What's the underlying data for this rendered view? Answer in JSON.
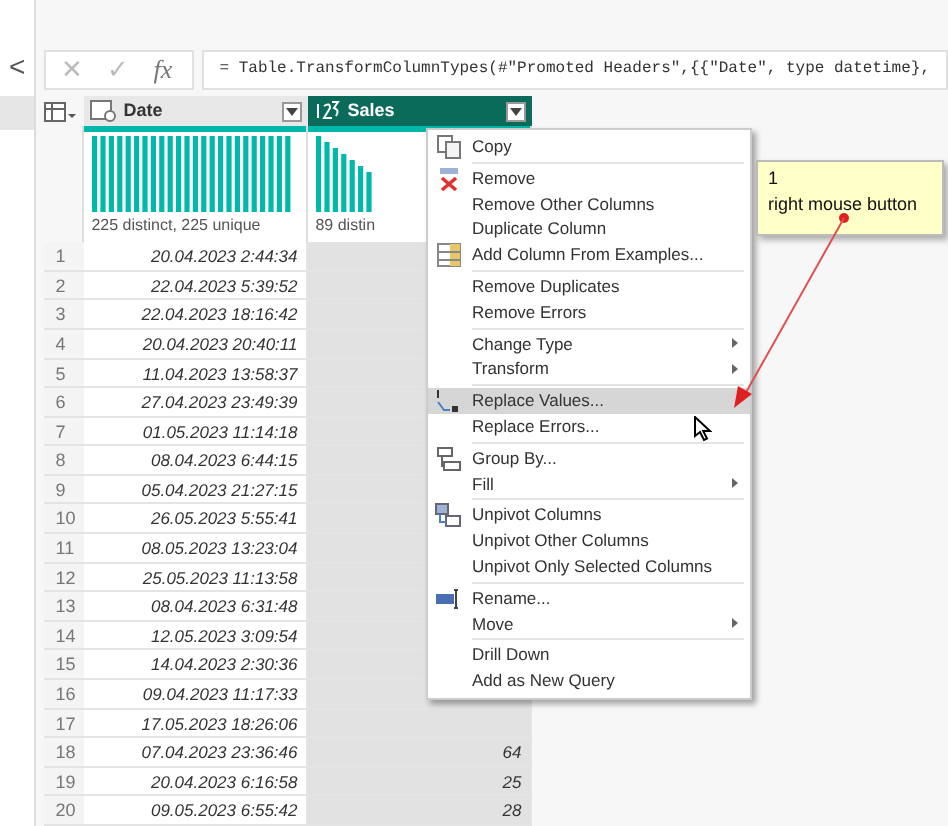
{
  "nav": {
    "collapse": "<"
  },
  "formula_bar": {
    "cancel": "✕",
    "commit": "✓",
    "fx": "fx",
    "formula": "= Table.TransformColumnTypes(#\"Promoted Headers\",{{\"Date\", type datetime},"
  },
  "table": {
    "columns": [
      {
        "name": "Date",
        "selected": false,
        "stats": "225 distinct, 225 unique"
      },
      {
        "name": "Sales",
        "selected": true,
        "stats": "89 distin"
      }
    ],
    "rows": [
      {
        "n": "1",
        "date": "20.04.2023 2:44:34"
      },
      {
        "n": "2",
        "date": "22.04.2023 5:39:52"
      },
      {
        "n": "3",
        "date": "22.04.2023 18:16:42"
      },
      {
        "n": "4",
        "date": "20.04.2023 20:40:11"
      },
      {
        "n": "5",
        "date": "11.04.2023 13:58:37"
      },
      {
        "n": "6",
        "date": "27.04.2023 23:49:39"
      },
      {
        "n": "7",
        "date": "01.05.2023 11:14:18"
      },
      {
        "n": "8",
        "date": "08.04.2023 6:44:15"
      },
      {
        "n": "9",
        "date": "05.04.2023 21:27:15"
      },
      {
        "n": "10",
        "date": "26.05.2023 5:55:41"
      },
      {
        "n": "11",
        "date": "08.05.2023 13:23:04"
      },
      {
        "n": "12",
        "date": "25.05.2023 11:13:58"
      },
      {
        "n": "13",
        "date": "08.04.2023 6:31:48"
      },
      {
        "n": "14",
        "date": "12.05.2023 3:09:54"
      },
      {
        "n": "15",
        "date": "14.04.2023 2:30:36"
      },
      {
        "n": "16",
        "date": "09.04.2023 11:17:33"
      },
      {
        "n": "17",
        "date": "17.05.2023 18:26:06"
      },
      {
        "n": "18",
        "date": "07.04.2023 23:36:46",
        "sales": "64"
      },
      {
        "n": "19",
        "date": "20.04.2023 6:16:58",
        "sales": "25"
      },
      {
        "n": "20",
        "date": "09.05.2023 6:55:42",
        "sales": "28"
      }
    ]
  },
  "context_menu": {
    "items": [
      {
        "kind": "item",
        "label": "Copy",
        "selected": false
      },
      {
        "kind": "separator"
      },
      {
        "kind": "item",
        "label": "Remove",
        "selected": false
      },
      {
        "kind": "item",
        "label": "Remove Other Columns",
        "selected": false
      },
      {
        "kind": "item",
        "label": "Duplicate Column",
        "selected": false
      },
      {
        "kind": "item",
        "label": "Add Column From Examples...",
        "selected": false
      },
      {
        "kind": "separator"
      },
      {
        "kind": "item",
        "label": "Remove Duplicates",
        "selected": false
      },
      {
        "kind": "item",
        "label": "Remove Errors",
        "selected": false
      },
      {
        "kind": "separator"
      },
      {
        "kind": "submenu",
        "label": "Change Type",
        "selected": false
      },
      {
        "kind": "submenu",
        "label": "Transform",
        "selected": false
      },
      {
        "kind": "separator"
      },
      {
        "kind": "item",
        "label": "Replace Values...",
        "selected": true
      },
      {
        "kind": "item",
        "label": "Replace Errors...",
        "selected": false
      },
      {
        "kind": "separator"
      },
      {
        "kind": "item",
        "label": "Group By...",
        "selected": false
      },
      {
        "kind": "submenu",
        "label": "Fill",
        "selected": false
      },
      {
        "kind": "separator"
      },
      {
        "kind": "item",
        "label": "Unpivot Columns",
        "selected": false
      },
      {
        "kind": "item",
        "label": "Unpivot Other Columns",
        "selected": false
      },
      {
        "kind": "item",
        "label": "Unpivot Only Selected Columns",
        "selected": false
      },
      {
        "kind": "separator"
      },
      {
        "kind": "item",
        "label": "Rename...",
        "selected": false
      },
      {
        "kind": "submenu",
        "label": "Move",
        "selected": false
      },
      {
        "kind": "separator"
      },
      {
        "kind": "item",
        "label": "Drill Down",
        "selected": false
      },
      {
        "kind": "item",
        "label": "Add as New Query",
        "selected": false
      }
    ]
  },
  "callout": {
    "number": "1",
    "text": "right mouse button"
  }
}
